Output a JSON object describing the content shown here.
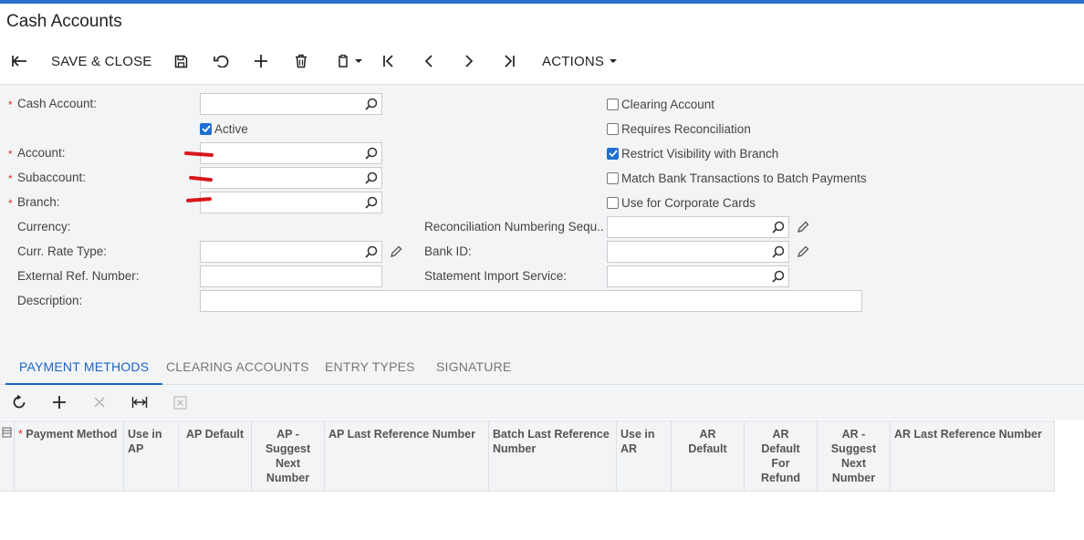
{
  "page": {
    "title": "Cash Accounts"
  },
  "toolbar": {
    "back_icon": "arrow-left-icon",
    "save_close_label": "SAVE & CLOSE",
    "actions_label": "ACTIONS"
  },
  "form": {
    "cash_account": {
      "label": "Cash Account:",
      "value": ""
    },
    "active": {
      "label": "Active",
      "checked": true
    },
    "account": {
      "label": "Account:",
      "value": ""
    },
    "subaccount": {
      "label": "Subaccount:",
      "value": ""
    },
    "branch": {
      "label": "Branch:",
      "value": ""
    },
    "currency": {
      "label": "Currency:"
    },
    "curr_rate_type": {
      "label": "Curr. Rate Type:",
      "value": ""
    },
    "external_ref": {
      "label": "External Ref. Number:",
      "value": ""
    },
    "description": {
      "label": "Description:",
      "value": ""
    },
    "reconciliation_seq": {
      "label": "Reconciliation Numbering Sequ...",
      "value": ""
    },
    "bank_id": {
      "label": "Bank ID:",
      "value": ""
    },
    "statement_import": {
      "label": "Statement Import Service:",
      "value": ""
    },
    "checkboxes": [
      {
        "label": "Clearing Account",
        "checked": false
      },
      {
        "label": "Requires Reconciliation",
        "checked": false
      },
      {
        "label": "Restrict Visibility with Branch",
        "checked": true
      },
      {
        "label": "Match Bank Transactions to Batch Payments",
        "checked": false
      },
      {
        "label": "Use for Corporate Cards",
        "checked": false
      }
    ]
  },
  "tabs": [
    {
      "label": "PAYMENT METHODS",
      "active": true
    },
    {
      "label": "CLEARING ACCOUNTS",
      "active": false
    },
    {
      "label": "ENTRY TYPES",
      "active": false
    },
    {
      "label": "SIGNATURE",
      "active": false
    }
  ],
  "grid": {
    "columns": [
      "Payment Method",
      "Use in AP",
      "AP Default",
      "AP - Suggest Next Number",
      "AP Last Reference Number",
      "Batch Last Reference Number",
      "Use in AR",
      "AR Default",
      "AR Default For Refund",
      "AR - Suggest Next Number",
      "AR Last Reference Number"
    ],
    "rows": []
  },
  "colors": {
    "accent": "#1d64c4",
    "top_bar": "#2d6fd1",
    "required": "#d9302f",
    "annotation": "#d8161b"
  }
}
